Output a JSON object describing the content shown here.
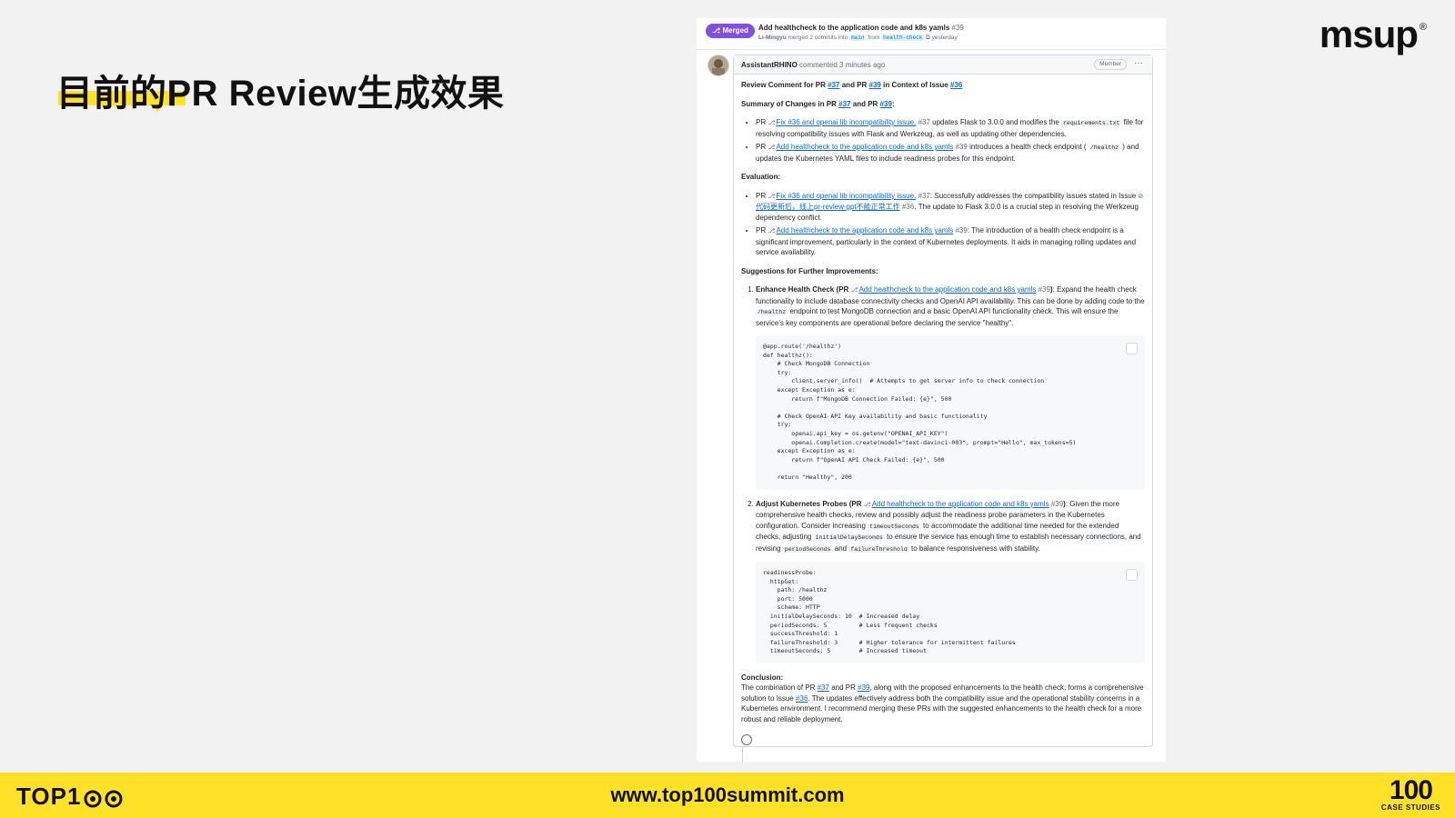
{
  "slide": {
    "title": "目前的PR Review生成效果",
    "logo": "msup",
    "logo_mark": "®",
    "footer_brand": "TOP1",
    "footer_url": "www.top100summit.com",
    "footer_right_number": "100",
    "footer_right_text": "CASE STUDIES"
  },
  "pr": {
    "status": "Merged",
    "title": "Add healthcheck to the application code and k8s yamls",
    "number": "#39",
    "author": "Li-Mingyu",
    "merge_text": "merged 2 commits into",
    "base_branch": "main",
    "from_text": "from",
    "head_branch": "health-check",
    "time": "yesterday"
  },
  "comment": {
    "author": "AssistantRHINO",
    "action": "commented 3 minutes ago",
    "badge": "Member",
    "menu": "···",
    "heading": {
      "prefix": "Review Comment for PR",
      "pr_a": "#37",
      "and": "and PR",
      "pr_b": "#39",
      "ctx": "in Context of Issue",
      "issue": "#36"
    },
    "summary": {
      "prefix": "Summary of Changes in PR",
      "pr_a": "#37",
      "and": "and PR",
      "pr_b": "#39",
      "colon": ":"
    },
    "changes": [
      {
        "pr": "PR",
        "link": "Fix #36 and openai lib incompatibility issue.",
        "num": "#37",
        "text_a": "updates Flask to 3.0.0 and modifies the",
        "code": "requirements.txt",
        "text_b": "file for resolving compatibility issues with Flask and Werkzeug, as well as updating other dependencies."
      },
      {
        "pr": "PR",
        "link": "Add healthcheck to the application code and k8s yamls",
        "num": "#39",
        "text_a": "introduces a health check endpoint (",
        "code": "/healthz",
        "text_b": ") and updates the Kubernetes YAML files to include readiness probes for this endpoint."
      }
    ],
    "evaluation_label": "Evaluation:",
    "evaluation": [
      {
        "pr": "PR",
        "link": "Fix #36 and openai lib incompatibility issue.",
        "num": "#37",
        "text_a": ": Successfully addresses the compatibility issues stated in Issue",
        "issue_link": "代码更新后，线上pr-review-gpt不能正常工作",
        "issue_num": "#36",
        "text_b": ". The update to Flask 3.0.0 is a crucial step in resolving the Werkzeug dependency conflict."
      },
      {
        "pr": "PR",
        "link": "Add healthcheck to the application code and k8s yamls",
        "num": "#39",
        "text_a": ": The introduction of a health check endpoint is a significant improvement, particularly in the context of Kubernetes deployments. It aids in managing rolling updates and service availability."
      }
    ],
    "suggestions_label": "Suggestions for Further Improvements:",
    "suggestions": [
      {
        "title": "Enhance Health Check (PR",
        "link": "Add healthcheck to the application code and k8s yamls",
        "num": "#39",
        "close": ")",
        "text_a": ": Expand the health check functionality to include database connectivity checks and OpenAI API availability. This can be done by adding code to the",
        "code": "/healthz",
        "text_b": "endpoint to test MongoDB connection and a basic OpenAI API functionality check. This will ensure the service's key components are operational before declaring the service \"healthy\".",
        "snippet": "@app.route('/healthz')\ndef healthz():\n    # Check MongoDB Connection\n    try:\n        client.server_info()  # Attempts to get server info to check connection\n    except Exception as e:\n        return f\"MongoDB Connection Failed: {e}\", 500\n\n    # Check OpenAI API Key availability and basic functionality\n    try:\n        openai.api_key = os.getenv(\"OPENAI_API_KEY\")\n        openai.Completion.create(model=\"text-davinci-003\", prompt=\"Hello\", max_tokens=5)\n    except Exception as e:\n        return f\"OpenAI API Check Failed: {e}\", 500\n\n    return \"Healthy\", 200"
      },
      {
        "title": "Adjust Kubernetes Probes (PR",
        "link": "Add healthcheck to the application code and k8s yamls",
        "num": "#39",
        "close": ")",
        "text_a": ": Given the more comprehensive health checks, review and possibly adjust the readiness probe parameters in the Kubernetes configuration. Consider increasing",
        "code_a": "timeoutSeconds",
        "text_b": "to accommodate the additional time needed for the extended checks, adjusting",
        "code_b": "initialDelaySeconds",
        "text_c": "to ensure the service has enough time to establish necessary connections, and revising",
        "code_c": "periodSeconds",
        "text_d": "and",
        "code_d": "failureThreshold",
        "text_e": "to balance responsiveness with stability.",
        "snippet": "readinessProbe:\n  httpGet:\n    path: /healthz\n    port: 5000\n    scheme: HTTP\n  initialDelaySeconds: 10  # Increased delay\n  periodSeconds: 5         # Less frequent checks\n  successThreshold: 1\n  failureThreshold: 3      # Higher tolerance for intermittent failures\n  timeoutSeconds: 5        # Increased timeout"
      }
    ],
    "conclusion_label": "Conclusion:",
    "conclusion": {
      "a": "The combination of PR",
      "pr_a": "#37",
      "b": "and PR",
      "pr_b": "#39",
      "c": ", along with the proposed enhancements to the health check, forms a comprehensive solution to Issue",
      "issue": "#36",
      "d": ". The updates effectively address both the compatibility issue and the operational stability concerns in a Kubernetes environment. I recommend merging these PRs with the suggested enhancements to the health check for a more robust and reliable deployment."
    }
  }
}
